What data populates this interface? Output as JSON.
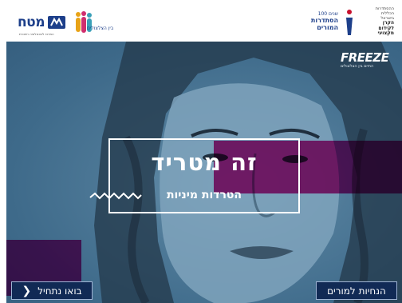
{
  "header": {
    "logo_matach": {
      "name": "מטח",
      "tagline": "המרכז לטכנולוגיה חינוכית"
    },
    "logo_bayn": {
      "name": "בין הצלצולים"
    },
    "logo_histadrut": {
      "line1": "100 שנים",
      "line2": "הסתדרות המורים"
    },
    "logo_fund": {
      "lines": [
        "ההסתדרות",
        "הכללית",
        "בישראל",
        "הקרן",
        "לקידום",
        "מקצועי"
      ]
    }
  },
  "hero": {
    "brand": {
      "name": "FREEZE",
      "tagline": "החיים בין הצלצולים"
    },
    "headline": "זה מטריד",
    "subheadline": "הטרדות מיניות"
  },
  "buttons": {
    "start_label": "בואו נתחיל",
    "teachers_label": "הנחיות למורים"
  },
  "colors": {
    "accent_pink": "#e0167f",
    "button_navy": "#112a55",
    "brand_blue": "#1d3f8a"
  }
}
